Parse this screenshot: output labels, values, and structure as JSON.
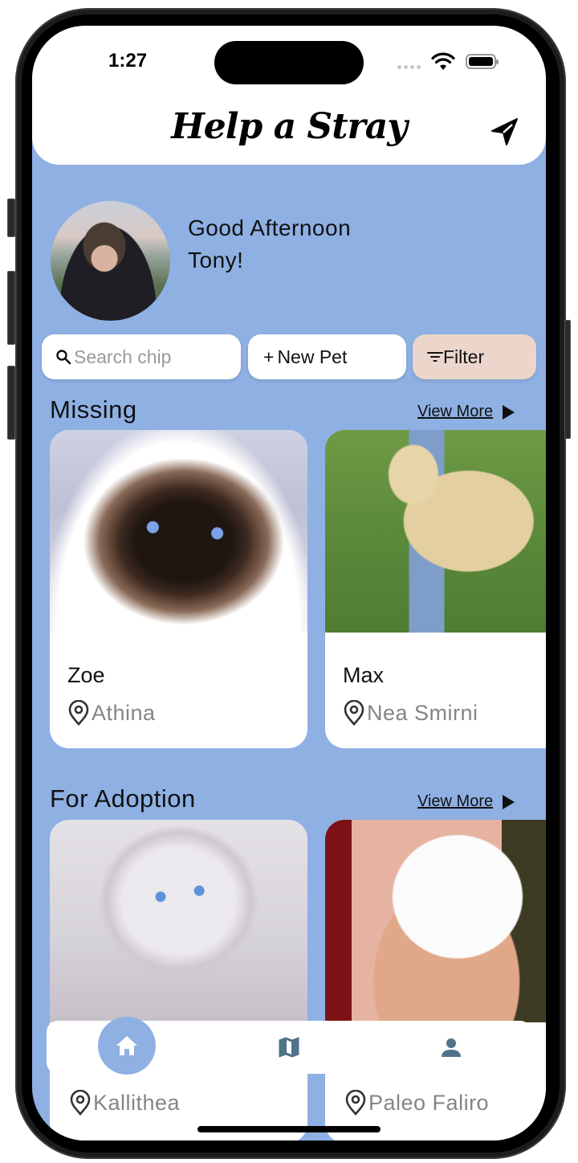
{
  "status_bar": {
    "time": "1:27"
  },
  "header": {
    "title": "Help a Stray",
    "send_icon": "send-icon"
  },
  "greeting": {
    "line1": "Good Afternoon",
    "line2": "Tony!"
  },
  "actions": {
    "search_placeholder": "Search chip",
    "search_value": "",
    "new_pet_label": "New Pet",
    "new_pet_prefix": "+",
    "filter_label": "Filter"
  },
  "sections": [
    {
      "title": "Missing",
      "view_more": "View More",
      "pets": [
        {
          "name": "Zoe",
          "location": "Athina",
          "image": "siamese-ragdoll-cat"
        },
        {
          "name": "Max",
          "location": "Nea Smirni",
          "image": "yellow-labrador-dog"
        }
      ]
    },
    {
      "title": "For Adoption",
      "view_more": "View More",
      "pets": [
        {
          "name": "",
          "location": "Kallithea",
          "image": "white-ragdoll-kitten"
        },
        {
          "name": "",
          "location": "Paleo Faliro",
          "image": "white-rabbit-in-hands"
        }
      ]
    }
  ],
  "bottom_nav": {
    "items": [
      {
        "icon": "home-icon",
        "active": true
      },
      {
        "icon": "map-icon",
        "active": false
      },
      {
        "icon": "person-icon",
        "active": false
      }
    ]
  },
  "colors": {
    "background": "#8eb0e3",
    "filter_chip": "#ecd6cb",
    "nav_icon": "#4f7388",
    "location_text": "#858585"
  }
}
